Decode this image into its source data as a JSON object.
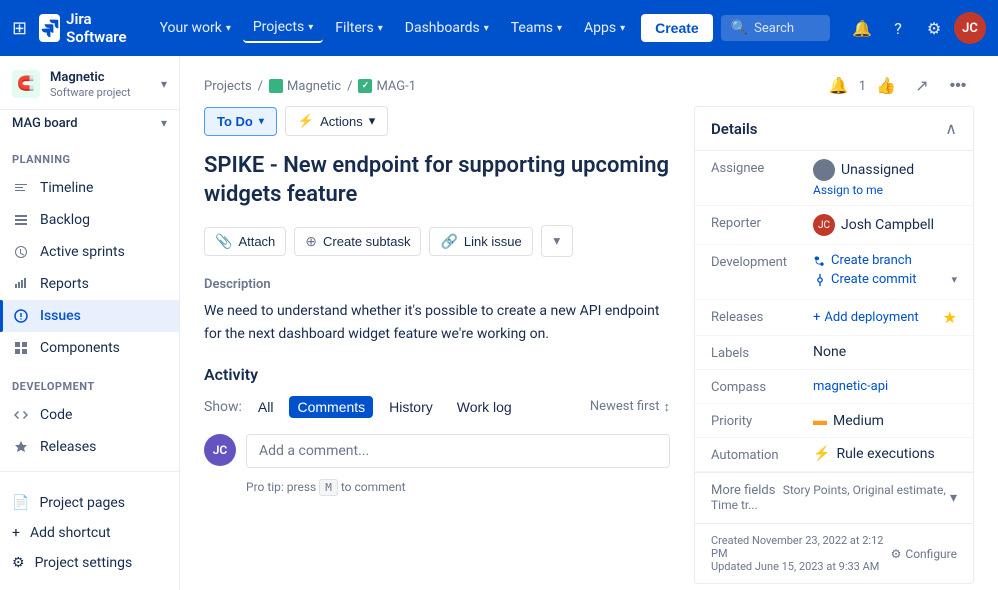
{
  "topnav": {
    "logo_text": "Jira Software",
    "your_work_label": "Your work",
    "projects_label": "Projects",
    "filters_label": "Filters",
    "dashboards_label": "Dashboards",
    "teams_label": "Teams",
    "apps_label": "Apps",
    "create_label": "Create",
    "search_placeholder": "Search"
  },
  "sidebar": {
    "project_name": "Magnetic",
    "project_type": "Software project",
    "planning_label": "PLANNING",
    "mag_board": "MAG board",
    "timeline_label": "Timeline",
    "backlog_label": "Backlog",
    "active_sprints_label": "Active sprints",
    "reports_label": "Reports",
    "issues_label": "Issues",
    "components_label": "Components",
    "development_label": "DEVELOPMENT",
    "code_label": "Code",
    "releases_label": "Releases",
    "project_pages_label": "Project pages",
    "add_shortcut_label": "Add shortcut",
    "project_settings_label": "Project settings"
  },
  "breadcrumb": {
    "projects": "Projects",
    "magnetic": "Magnetic",
    "issue_id": "MAG-1"
  },
  "issue": {
    "title": "SPIKE - New endpoint for supporting upcoming widgets feature",
    "description_label": "Description",
    "description_text": "We need to understand whether it's possible to create a new API endpoint for the next dashboard widget feature we're working on.",
    "attach_label": "Attach",
    "create_subtask_label": "Create subtask",
    "link_issue_label": "Link issue",
    "status": "To Do",
    "actions_label": "Actions",
    "activity_label": "Activity",
    "show_label": "Show:",
    "filter_all": "All",
    "filter_comments": "Comments",
    "filter_history": "History",
    "filter_worklog": "Work log",
    "newest_first": "Newest first",
    "comment_placeholder": "Add a comment...",
    "pro_tip": "Pro tip: press",
    "pro_tip_key": "M",
    "pro_tip_suffix": "to comment"
  },
  "details": {
    "header": "Details",
    "assignee_label": "Assignee",
    "assignee_value": "Unassigned",
    "assign_me": "Assign to me",
    "reporter_label": "Reporter",
    "reporter_name": "Josh Campbell",
    "development_label": "Development",
    "create_branch": "Create branch",
    "create_commit": "Create commit",
    "releases_label": "Releases",
    "add_deployment": "Add deployment",
    "labels_label": "Labels",
    "labels_value": "None",
    "compass_label": "Compass",
    "compass_value": "magnetic-api",
    "priority_label": "Priority",
    "priority_value": "Medium",
    "automation_label": "Automation",
    "automation_value": "Rule executions",
    "more_fields_text": "More fields",
    "more_fields_sub": "Story Points, Original estimate, Time tr...",
    "footer_created": "Created November 23, 2022 at 2:12 PM",
    "footer_updated": "Updated June 15, 2023 at 9:33 AM",
    "configure_label": "Configure"
  }
}
